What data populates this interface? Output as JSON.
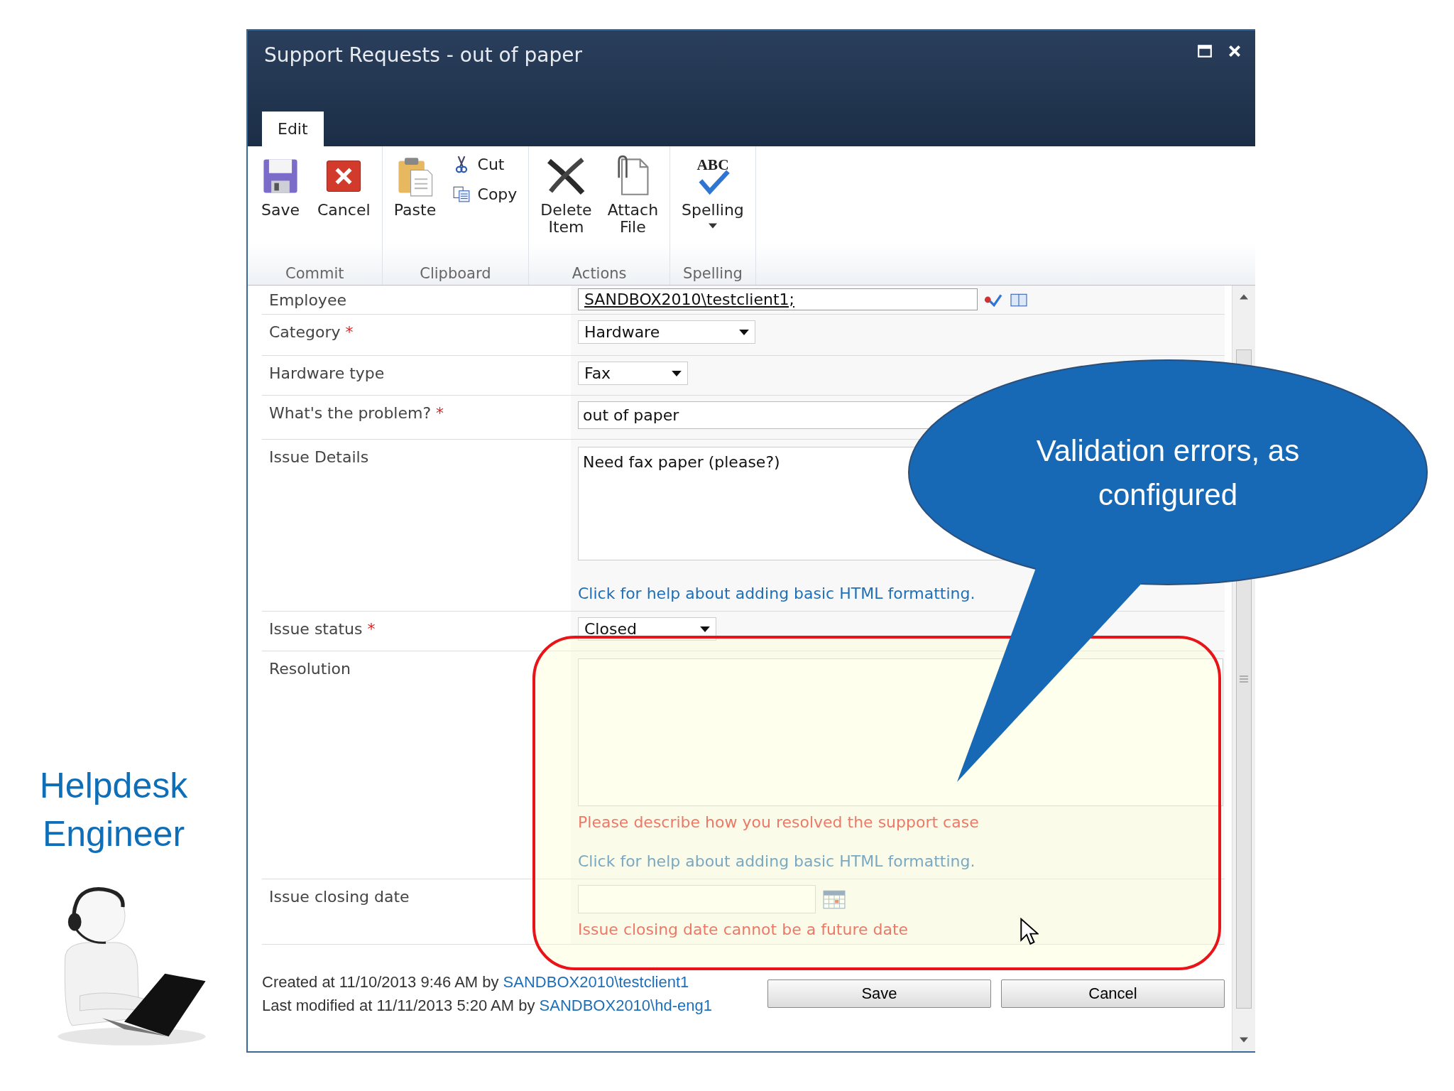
{
  "side_title": "Helpdesk Engineer",
  "callout": {
    "text": "Validation errors, as configured"
  },
  "window": {
    "title": "Support Requests - out of paper"
  },
  "tabs": [
    {
      "label": "Edit",
      "selected": true
    }
  ],
  "ribbon": {
    "groups": [
      {
        "label": "Commit",
        "items": [
          {
            "kind": "large",
            "label": "Save"
          },
          {
            "kind": "large",
            "label": "Cancel"
          }
        ]
      },
      {
        "label": "Clipboard",
        "items": [
          {
            "kind": "large",
            "label": "Paste"
          },
          {
            "kind": "small",
            "label": "Cut"
          },
          {
            "kind": "small",
            "label": "Copy"
          }
        ]
      },
      {
        "label": "Actions",
        "items": [
          {
            "kind": "large",
            "label": "Delete Item"
          },
          {
            "kind": "large",
            "label": "Attach File"
          }
        ]
      },
      {
        "label": "Spelling",
        "items": [
          {
            "kind": "split",
            "label": "Spelling",
            "icon_text": "ABC"
          }
        ]
      }
    ]
  },
  "form": {
    "fields": [
      {
        "label": "Employee",
        "kind": "people",
        "value": "SANDBOX2010\\testclient1;"
      },
      {
        "label": "Category",
        "mark": "*",
        "kind": "select",
        "value": "Hardware"
      },
      {
        "label": "Hardware type",
        "kind": "select",
        "value": "Fax"
      },
      {
        "label": "What's the problem?",
        "mark": "*",
        "kind": "text",
        "value": "out of paper"
      },
      {
        "label": "Issue Details",
        "kind": "note",
        "value": "Need fax paper (please?)",
        "help": "Click for help about adding basic HTML formatting."
      },
      {
        "label": "Issue status",
        "mark": "*",
        "kind": "select",
        "value": "Closed"
      },
      {
        "label": "Resolution",
        "kind": "note",
        "error": "Please describe how you resolved the support case",
        "help": "Click for help about adding basic HTML formatting."
      },
      {
        "label": "Issue closing date",
        "kind": "date",
        "error": "Issue closing date cannot be a future date"
      }
    ]
  },
  "footer": {
    "created": {
      "text": "Created at 11/10/2013 9:46 AM by",
      "user": "SANDBOX2010\\testclient1"
    },
    "modified": {
      "text": "Last modified at 11/11/2013 5:20 AM by",
      "user": "SANDBOX2010\\hd-eng1"
    },
    "buttons": [
      "Save",
      "Cancel"
    ]
  }
}
